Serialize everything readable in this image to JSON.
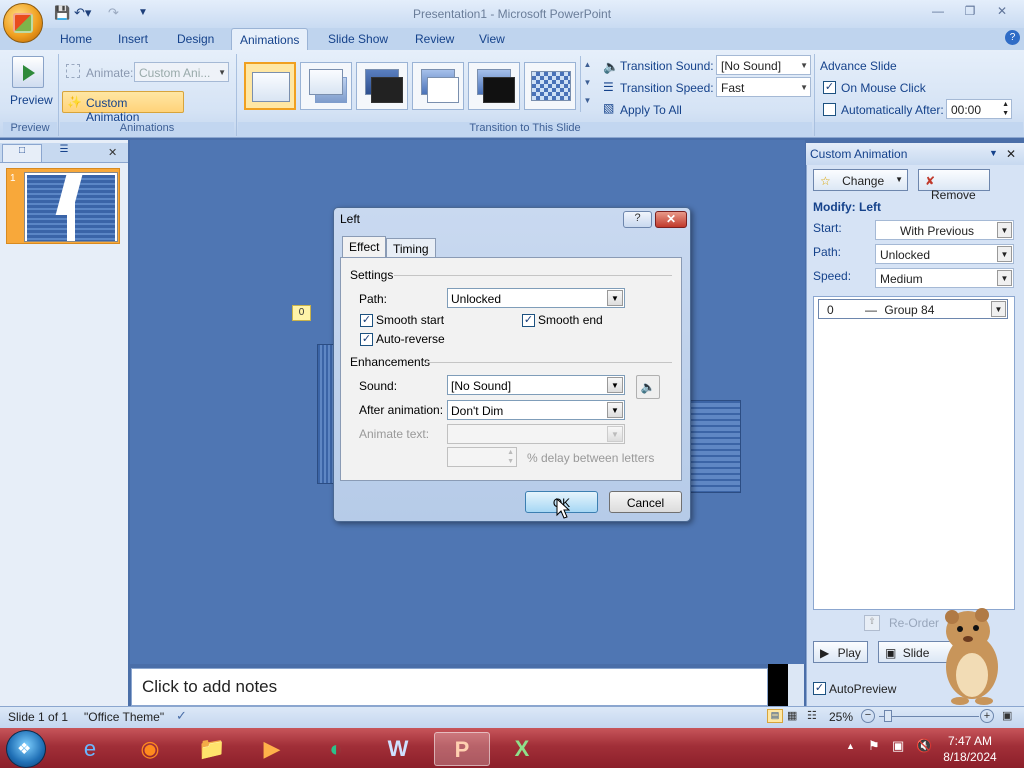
{
  "app": {
    "window_title": "Presentation1 - Microsoft PowerPoint",
    "quick_access": [
      "save-icon",
      "undo-icon",
      "redo-icon",
      "customize-icon"
    ],
    "window_controls": [
      "minimize-icon",
      "restore-icon",
      "close-icon"
    ]
  },
  "ribbon": {
    "tabs": [
      "Home",
      "Insert",
      "Design",
      "Animations",
      "Slide Show",
      "Review",
      "View"
    ],
    "active_tab": "Animations",
    "preview": {
      "label": "Preview",
      "group": "Preview"
    },
    "animations": {
      "animate_label": "Animate:",
      "animate_value": "Custom Ani...",
      "custom_animation_label": "Custom Animation",
      "group": "Animations"
    },
    "transition": {
      "sound_label": "Transition Sound:",
      "sound_value": "[No Sound]",
      "speed_label": "Transition Speed:",
      "speed_value": "Fast",
      "apply_all_label": "Apply To All",
      "group": "Transition to This Slide"
    },
    "advance": {
      "title": "Advance Slide",
      "on_mouse_click_label": "On Mouse Click",
      "on_mouse_click_checked": true,
      "auto_after_label": "Automatically After:",
      "auto_after_checked": false,
      "auto_after_value": "00:00"
    }
  },
  "slides_panel": {
    "slide_number": "1"
  },
  "slide": {
    "animation_tag": "0"
  },
  "notes": {
    "placeholder": "Click to add notes"
  },
  "task_pane": {
    "title": "Custom Animation",
    "change_label": "Change",
    "remove_label": "Remove",
    "modify_label": "Modify: Left",
    "start_label": "Start:",
    "start_value": "With Previous",
    "path_label": "Path:",
    "path_value": "Unlocked",
    "speed_label": "Speed:",
    "speed_value": "Medium",
    "list_items": [
      {
        "order": "0",
        "name": "Group 84"
      }
    ],
    "reorder_label": "Re-Order",
    "play_label": "Play",
    "slideshow_label": "Slide Sho",
    "autopreview_label": "AutoPreview",
    "autopreview_checked": true
  },
  "status_bar": {
    "slide_info": "Slide 1 of 1",
    "theme": "\"Office Theme\"",
    "zoom": "25%"
  },
  "dialog": {
    "title": "Left",
    "tabs": [
      "Effect",
      "Timing"
    ],
    "active_tab": "Effect",
    "settings_heading": "Settings",
    "path_label": "Path:",
    "path_value": "Unlocked",
    "smooth_start_label": "Smooth start",
    "smooth_start_checked": true,
    "smooth_end_label": "Smooth end",
    "smooth_end_checked": true,
    "auto_reverse_label": "Auto-reverse",
    "auto_reverse_checked": true,
    "enhancements_heading": "Enhancements",
    "sound_label": "Sound:",
    "sound_value": "[No Sound]",
    "after_animation_label": "After animation:",
    "after_animation_value": "Don't Dim",
    "animate_text_label": "Animate text:",
    "animate_text_value": "",
    "delay_value": "",
    "delay_label": "% delay between letters",
    "ok_label": "OK",
    "cancel_label": "Cancel"
  },
  "taskbar": {
    "time": "7:47 AM",
    "date": "8/18/2024",
    "apps": [
      "internet-explorer-icon",
      "firefox-icon",
      "file-explorer-icon",
      "media-player-icon",
      "browser-icon",
      "word-icon",
      "powerpoint-icon",
      "excel-icon"
    ]
  }
}
